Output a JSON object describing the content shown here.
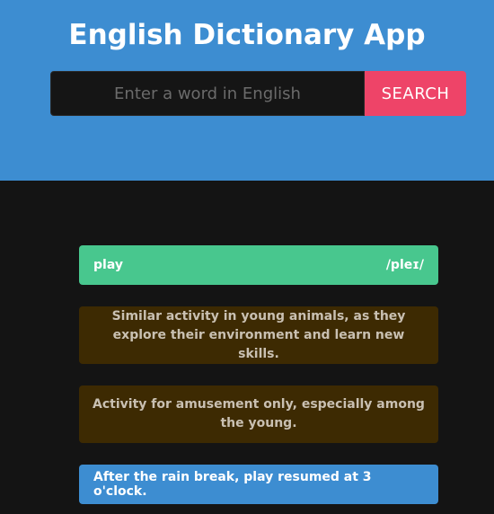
{
  "app": {
    "title": "English Dictionary App"
  },
  "search": {
    "placeholder": "Enter a word in English",
    "value": "",
    "button_label": "SEARCH"
  },
  "result": {
    "word": "play",
    "phonetic": "/pleɪ/",
    "definitions": [
      "Similar activity in young animals, as they explore their environment and learn new skills.",
      "Activity for amusement only, especially among the young."
    ],
    "example": "After the rain break, play resumed at 3 o'clock."
  },
  "colors": {
    "header_bg": "#3d8dd1",
    "page_bg": "#141414",
    "search_button": "#ee4468",
    "word_card": "#48c78e",
    "definition_card": "#3d2a02",
    "example_card": "#3d8dd1"
  }
}
